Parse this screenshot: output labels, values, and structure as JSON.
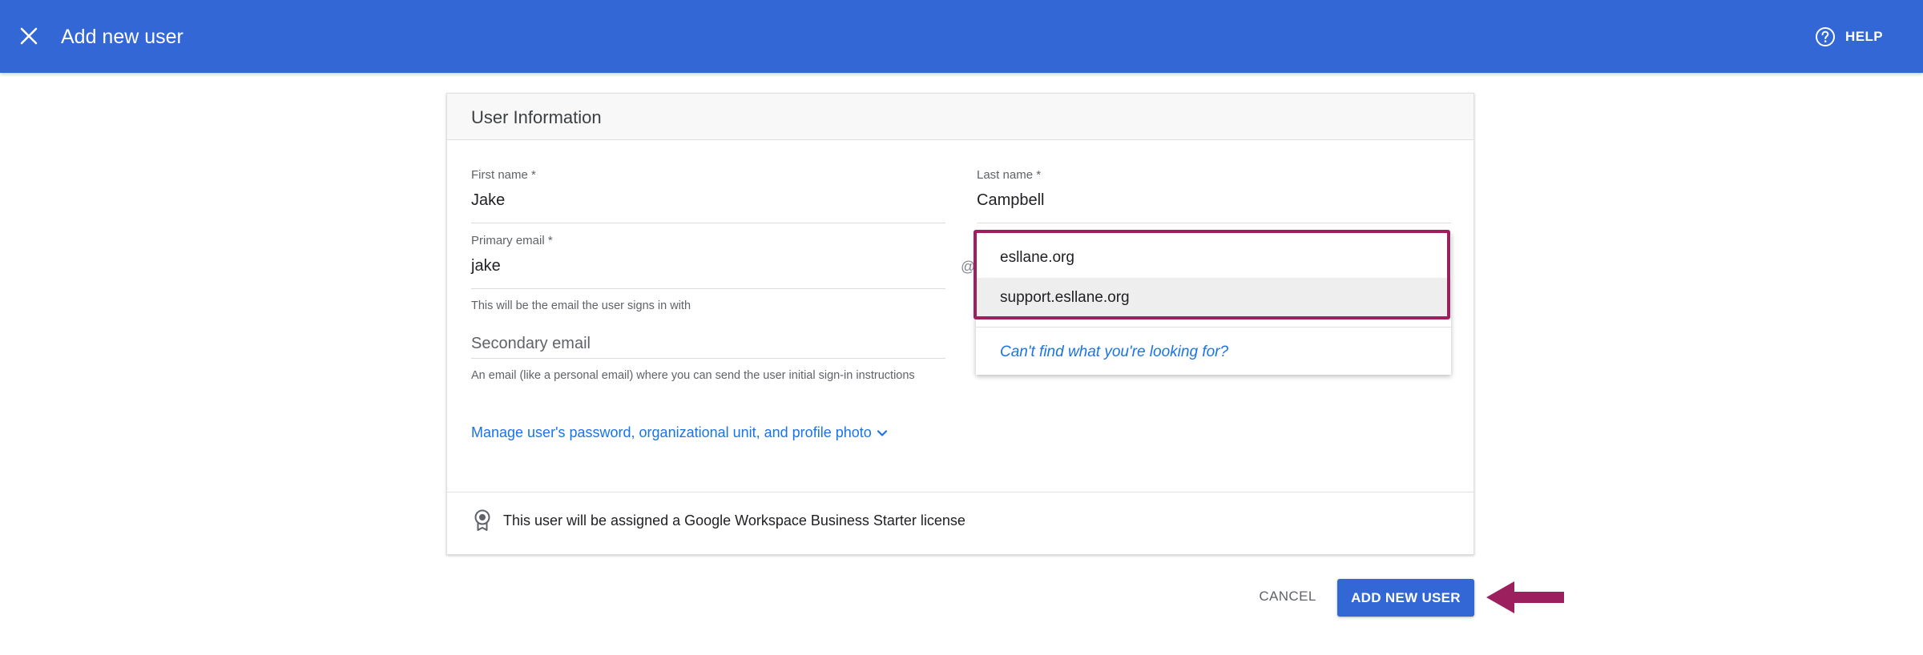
{
  "header": {
    "title": "Add new user",
    "help_label": "HELP",
    "close_icon": "close-icon",
    "help_icon": "help-circle-icon"
  },
  "user_info": {
    "title": "User Information",
    "first_name": {
      "label": "First name *",
      "value": "Jake"
    },
    "last_name": {
      "label": "Last name *",
      "value": "Campbell"
    },
    "primary_email": {
      "label": "Primary email *",
      "value": "jake",
      "at": "@",
      "hint": "This will be the email the user signs in with"
    },
    "secondary_email": {
      "placeholder": "Secondary email",
      "hint": "An email (like a personal email) where you can send the user initial sign-in instructions"
    },
    "manage_link": "Manage user's password, organizational unit, and profile photo",
    "license_text": "This user will be assigned a Google Workspace Business Starter license",
    "license_icon": "license-badge-icon"
  },
  "domain_dropdown": {
    "options": [
      "esllane.org",
      "support.esllane.org"
    ],
    "selected": "support.esllane.org",
    "footer": "Can't find what you're looking for?"
  },
  "actions": {
    "cancel_label": "CANCEL",
    "add_label": "ADD NEW USER"
  },
  "colors": {
    "header_bg": "#3367d6",
    "accent": "#1a73e8",
    "annotation": "#9c1f5e"
  }
}
